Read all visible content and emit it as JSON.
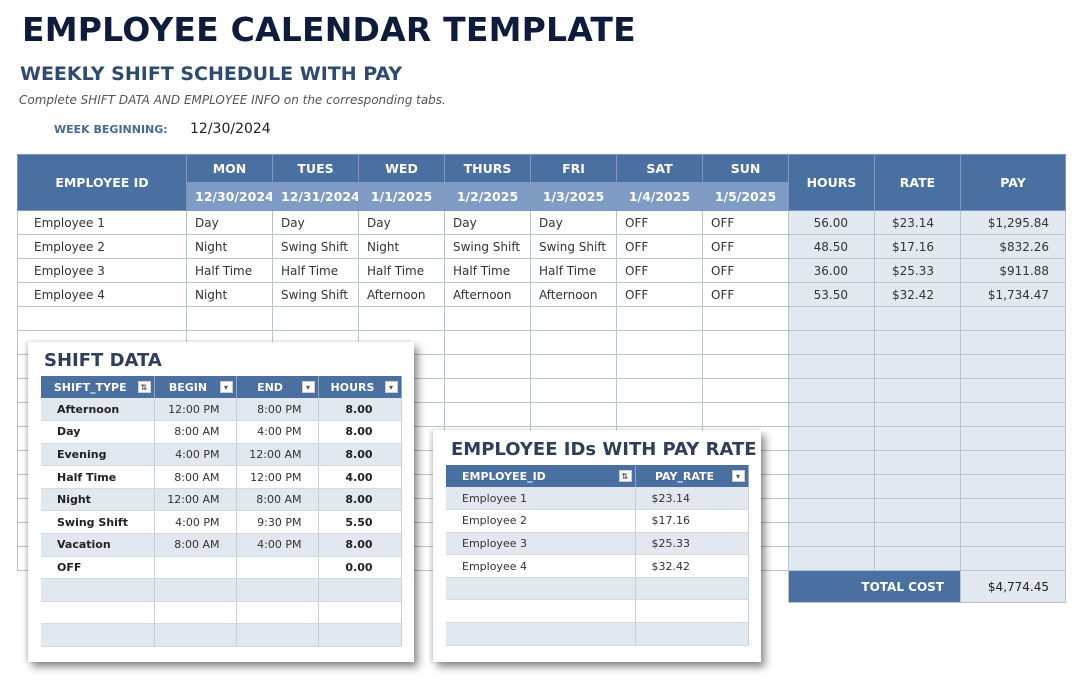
{
  "header": {
    "title": "EMPLOYEE CALENDAR TEMPLATE",
    "subtitle": "WEEKLY SHIFT SCHEDULE WITH PAY",
    "instructions": "Complete SHIFT DATA AND EMPLOYEE INFO on the corresponding tabs.",
    "week_beginning_label": "WEEK BEGINNING:",
    "week_beginning_value": "12/30/2024"
  },
  "colors": {
    "header_blue": "#4a6fa1",
    "date_row_blue": "#7f9cc4",
    "shade": "#e3e9f1",
    "title_navy": "#0f1b3d"
  },
  "schedule": {
    "employee_id_header": "EMPLOYEE ID",
    "days": [
      {
        "day": "MON",
        "date": "12/30/2024"
      },
      {
        "day": "TUES",
        "date": "12/31/2024"
      },
      {
        "day": "WED",
        "date": "1/1/2025"
      },
      {
        "day": "THURS",
        "date": "1/2/2025"
      },
      {
        "day": "FRI",
        "date": "1/3/2025"
      },
      {
        "day": "SAT",
        "date": "1/4/2025"
      },
      {
        "day": "SUN",
        "date": "1/5/2025"
      }
    ],
    "hours_header": "HOURS",
    "rate_header": "RATE",
    "pay_header": "PAY",
    "rows": [
      {
        "employee": "Employee 1",
        "shifts": [
          "Day",
          "Day",
          "Day",
          "Day",
          "Day",
          "OFF",
          "OFF"
        ],
        "hours": "56.00",
        "rate": "$23.14",
        "pay": "$1,295.84"
      },
      {
        "employee": "Employee 2",
        "shifts": [
          "Night",
          "Swing Shift",
          "Night",
          "Swing Shift",
          "Swing Shift",
          "OFF",
          "OFF"
        ],
        "hours": "48.50",
        "rate": "$17.16",
        "pay": "$832.26"
      },
      {
        "employee": "Employee 3",
        "shifts": [
          "Half Time",
          "Half Time",
          "Half Time",
          "Half Time",
          "Half Time",
          "OFF",
          "OFF"
        ],
        "hours": "36.00",
        "rate": "$25.33",
        "pay": "$911.88"
      },
      {
        "employee": "Employee 4",
        "shifts": [
          "Night",
          "Swing Shift",
          "Afternoon",
          "Afternoon",
          "Afternoon",
          "OFF",
          "OFF"
        ],
        "hours": "53.50",
        "rate": "$32.42",
        "pay": "$1,734.47"
      }
    ],
    "total_cost_label": "TOTAL COST",
    "total_cost_value": "$4,774.45"
  },
  "shift_data": {
    "title": "SHIFT DATA",
    "columns": [
      "SHIFT_TYPE",
      "BEGIN",
      "END",
      "HOURS"
    ],
    "filter_icons": [
      "sort-filter-icon",
      "dropdown-filter-icon",
      "dropdown-filter-icon",
      "dropdown-filter-icon"
    ],
    "rows": [
      {
        "type": "Afternoon",
        "begin": "12:00 PM",
        "end": "8:00 PM",
        "hours": "8.00"
      },
      {
        "type": "Day",
        "begin": "8:00 AM",
        "end": "4:00 PM",
        "hours": "8.00"
      },
      {
        "type": "Evening",
        "begin": "4:00 PM",
        "end": "12:00 AM",
        "hours": "8.00"
      },
      {
        "type": "Half Time",
        "begin": "8:00 AM",
        "end": "12:00 PM",
        "hours": "4.00"
      },
      {
        "type": "Night",
        "begin": "12:00 AM",
        "end": "8:00 AM",
        "hours": "8.00"
      },
      {
        "type": "Swing Shift",
        "begin": "4:00 PM",
        "end": "9:30 PM",
        "hours": "5.50"
      },
      {
        "type": "Vacation",
        "begin": "8:00 AM",
        "end": "4:00 PM",
        "hours": "8.00"
      },
      {
        "type": "OFF",
        "begin": "",
        "end": "",
        "hours": "0.00"
      }
    ]
  },
  "employee_rates": {
    "title": "EMPLOYEE IDs WITH PAY RATE",
    "columns": [
      "EMPLOYEE_ID",
      "PAY_RATE"
    ],
    "rows": [
      {
        "employee": "Employee 1",
        "rate": "$23.14"
      },
      {
        "employee": "Employee 2",
        "rate": "$17.16"
      },
      {
        "employee": "Employee 3",
        "rate": "$25.33"
      },
      {
        "employee": "Employee 4",
        "rate": "$32.42"
      }
    ]
  }
}
